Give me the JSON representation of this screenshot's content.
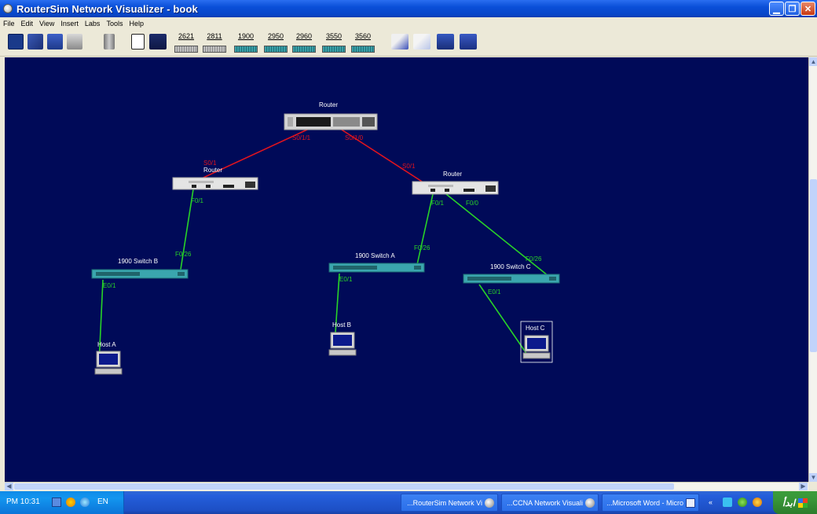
{
  "window": {
    "title": "RouterSim Network Visualizer - book"
  },
  "menu": [
    "File",
    "Edit",
    "View",
    "Insert",
    "Labs",
    "Tools",
    "Help"
  ],
  "toolbar": {
    "devices": [
      "2621",
      "2811",
      "1900",
      "2950",
      "2960",
      "3550",
      "3560"
    ]
  },
  "topology": {
    "devices": [
      {
        "id": "core",
        "label": "Router",
        "kind": "router-core"
      },
      {
        "id": "r_left",
        "label": "Router",
        "kind": "router"
      },
      {
        "id": "r_right",
        "label": "Router",
        "kind": "router"
      },
      {
        "id": "swB",
        "label": "1900 Switch B",
        "kind": "switch"
      },
      {
        "id": "swA",
        "label": "1900 Switch A",
        "kind": "switch"
      },
      {
        "id": "swC",
        "label": "1900 Switch C",
        "kind": "switch"
      },
      {
        "id": "hostA",
        "label": "Host A",
        "kind": "host"
      },
      {
        "id": "hostB",
        "label": "Host B",
        "kind": "host"
      },
      {
        "id": "hostC",
        "label": "Host C",
        "kind": "host"
      }
    ],
    "links": [
      {
        "from": "core",
        "to": "r_left",
        "kind": "serial",
        "labels": [
          "S0/1/1",
          "S0/1"
        ]
      },
      {
        "from": "core",
        "to": "r_right",
        "kind": "serial",
        "labels": [
          "S0/1/0",
          "S0/1"
        ]
      },
      {
        "from": "r_left",
        "to": "swB",
        "kind": "ethernet",
        "labels": [
          "F0/1",
          "F0/26"
        ]
      },
      {
        "from": "r_right",
        "to": "swA",
        "kind": "ethernet",
        "labels": [
          "F0/1",
          "F0/26"
        ]
      },
      {
        "from": "r_right",
        "to": "swC",
        "kind": "ethernet",
        "labels": [
          "F0/0",
          "F0/26"
        ]
      },
      {
        "from": "swB",
        "to": "hostA",
        "kind": "ethernet",
        "labels": [
          "E0/1"
        ]
      },
      {
        "from": "swA",
        "to": "hostB",
        "kind": "ethernet",
        "labels": [
          "E0/1"
        ]
      },
      {
        "from": "swC",
        "to": "hostC",
        "kind": "ethernet",
        "labels": [
          "E0/1"
        ]
      }
    ]
  },
  "taskbar": {
    "clock": "PM 10:31",
    "language": "EN",
    "tasks": [
      "...RouterSim Network Vi",
      "...CCNA Network Visuali",
      "...Microsoft Word - Micro"
    ],
    "start_label": "ابدأ"
  },
  "colors": {
    "canvas": "#000a58",
    "serial_link": "#e0141e",
    "ethernet_link": "#28d228",
    "titlebar": "#0a4fd8"
  }
}
